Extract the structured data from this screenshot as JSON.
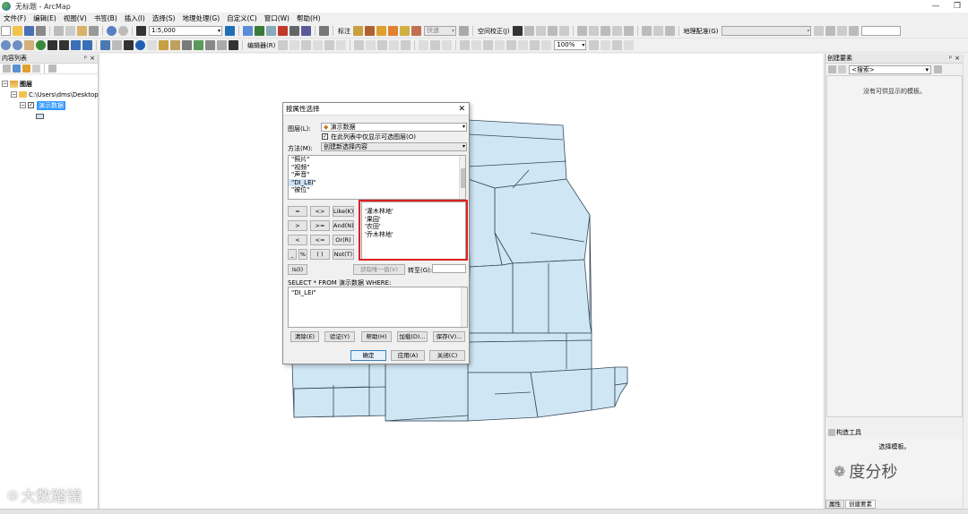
{
  "window": {
    "title": "无标题 - ArcMap",
    "minimize": "—",
    "restore": "❐",
    "close": "✕"
  },
  "menu": [
    "文件(F)",
    "编辑(E)",
    "视图(V)",
    "书签(B)",
    "插入(I)",
    "选择(S)",
    "地理处理(G)",
    "自定义(C)",
    "窗口(W)",
    "帮助(H)"
  ],
  "toolbar1": {
    "scale": "1:5,000",
    "label_menu": "标注",
    "fast_combo": "快速",
    "spatial_adjust": "空间校正(J)",
    "georef": "地理配准(G)"
  },
  "toolbar2": {
    "editor": "编辑器(R)",
    "zoom": "100%"
  },
  "toc": {
    "title": "内容列表",
    "root": "图层",
    "folder": "C:\\Users\\dms\\Desktop",
    "layer": "演示数据"
  },
  "right_pane": {
    "title": "创建要素",
    "search_placeholder": "<搜索>",
    "empty_text": "没有可供显示的模板。",
    "construct_title": "构造工具",
    "select_template": "选择模板。",
    "tab1": "属性",
    "tab2": "创建要素"
  },
  "dialog": {
    "title": "按属性选择",
    "layer_label": "图层(L):",
    "layer_value": "演示数据",
    "only_selectable": "在此列表中仅显示可选图层(O)",
    "method_label": "方法(M):",
    "method_value": "创建新选择内容",
    "fields": [
      "\"照片\"",
      "\"视频\"",
      "\"声音\"",
      "\"DI_LEI\"",
      "\"被位\""
    ],
    "values": [
      "'灌木林地'",
      "'果园'",
      "'农田'",
      "'乔木林地'"
    ],
    "operators": {
      "eq": "=",
      "ne": "<>",
      "like": "Like(K)",
      "gt": ">",
      "ge": ">=",
      "and": "And(N)",
      "lt": "<",
      "le": "<=",
      "or": "Or(R)",
      "underscore": "_",
      "percent": "%",
      "parens": "( )",
      "not": "Not(T)",
      "is": "Is(I)"
    },
    "get_unique": "获取唯一值(V)",
    "goto_label": "转至(G):",
    "sql_prefix": "SELECT * FROM 演示数据 WHERE:",
    "sql_expression": "\"DI_LEI\"",
    "btn_clear": "清除(E)",
    "btn_verify": "验证(Y)",
    "btn_help": "帮助(H)",
    "btn_load": "加载(D)...",
    "btn_save": "保存(V)...",
    "btn_ok": "确定",
    "btn_apply": "应用(A)",
    "btn_close": "关闭(C)"
  },
  "watermarks": {
    "left": "大数踏镜",
    "right": "度分秒"
  },
  "colors": {
    "map_fill": "#cfe6f5",
    "map_stroke": "#3a4a5a",
    "highlight": "#e02020",
    "selection": "#3399ff"
  }
}
